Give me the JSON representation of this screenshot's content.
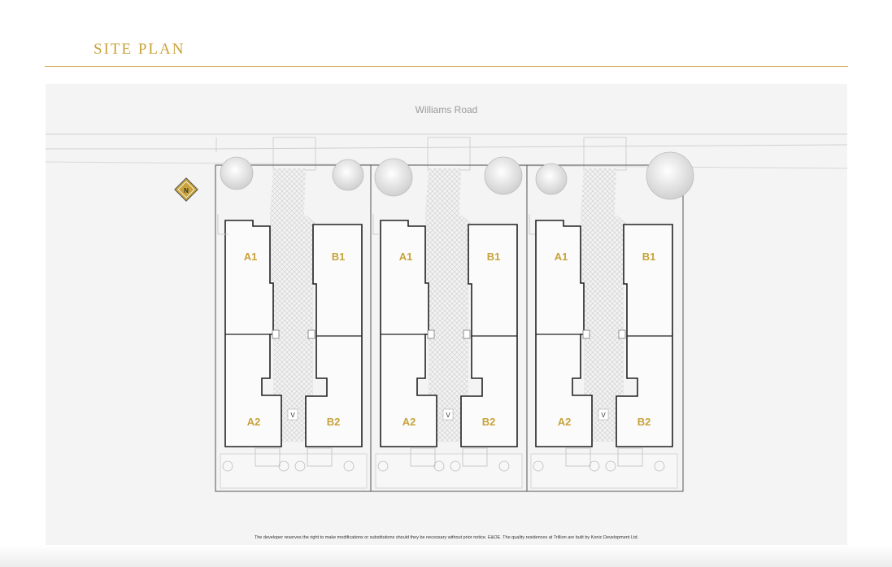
{
  "header": {
    "title": "SITE PLAN"
  },
  "plan": {
    "road_label": "Williams Road",
    "north_label": "N",
    "disclaimer": "The developer reserves the right to make modifications or substitutions should they be necessary without prior notice. E&OE. The quality residences at Trillion are built by Konic Development Ltd.",
    "lots": [
      {
        "units": [
          "A1",
          "B1",
          "A2",
          "B2"
        ],
        "driveway_label": "V"
      },
      {
        "units": [
          "A1",
          "B1",
          "A2",
          "B2"
        ],
        "driveway_label": "V"
      },
      {
        "units": [
          "A1",
          "B1",
          "A2",
          "B2"
        ],
        "driveway_label": "V"
      }
    ]
  },
  "colors": {
    "accent": "#c8a33b",
    "unit_label": "#c8a33b",
    "background": "#f4f4f4",
    "outline": "#222222"
  }
}
